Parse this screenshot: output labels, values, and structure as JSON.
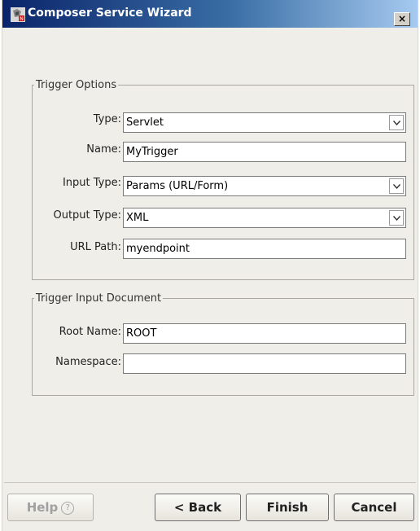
{
  "window": {
    "title": "Composer Service Wizard",
    "close_glyph": "×"
  },
  "trigger_options": {
    "legend": "Trigger Options",
    "type": {
      "label": "Type:",
      "value": "Servlet"
    },
    "name": {
      "label": "Name:",
      "value": "MyTrigger"
    },
    "input_type": {
      "label": "Input Type:",
      "value": "Params (URL/Form)"
    },
    "output_type": {
      "label": "Output Type:",
      "value": "XML"
    },
    "url_path": {
      "label": "URL Path:",
      "value": "myendpoint"
    }
  },
  "trigger_input_document": {
    "legend": "Trigger Input Document",
    "root_name": {
      "label": "Root Name:",
      "value": "ROOT"
    },
    "namespace": {
      "label": "Namespace:",
      "value": ""
    }
  },
  "buttons": {
    "help": "Help",
    "help_glyph": "?",
    "back": "< Back",
    "finish": "Finish",
    "cancel": "Cancel"
  },
  "colors": {
    "titlebar_start": "#0a246a",
    "titlebar_end": "#a6caf0",
    "dialog_bg": "#efeee8"
  },
  "icons": {
    "title": "app-wizard-icon",
    "dropdown": "chevron-down-icon",
    "close": "close-icon",
    "help": "question-circle-icon"
  }
}
